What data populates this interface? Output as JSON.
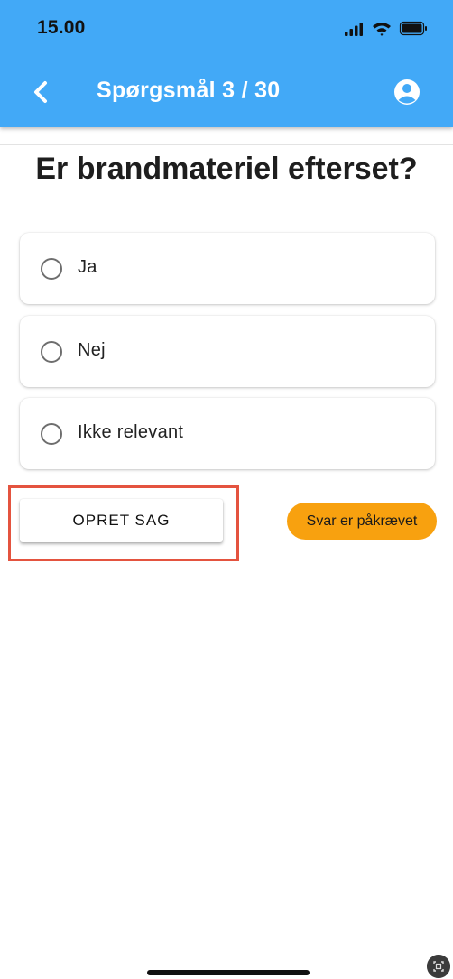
{
  "status_bar": {
    "time": "15.00",
    "icons": [
      "cellular-signal-icon",
      "wifi-icon",
      "battery-icon"
    ]
  },
  "header": {
    "title": "Spørgsmål 3 / 30",
    "back_icon": "chevron-left-icon",
    "profile_icon": "account-circle-icon",
    "background_color": "#42a9f7"
  },
  "question": {
    "text": "Er brandmateriel efterset?"
  },
  "options": [
    {
      "label": "Ja",
      "selected": false
    },
    {
      "label": "Nej",
      "selected": false
    },
    {
      "label": "Ikke relevant",
      "selected": false
    }
  ],
  "actions": {
    "create_case_label": "OPRET SAG",
    "required_badge": "Svar er påkrævet",
    "required_badge_color": "#f8a10f",
    "highlight_color": "#e4533f"
  }
}
